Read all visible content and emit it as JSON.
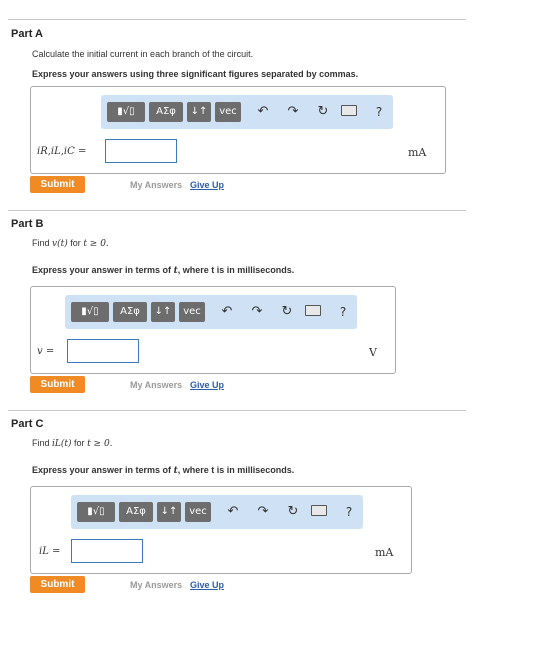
{
  "toolbar": {
    "fraction_root": "▮√▯",
    "greek": "ΑΣφ",
    "updown": "↓↑",
    "vec": "vec",
    "undo": "↶",
    "redo": "↷",
    "reset": "↻",
    "help": "?"
  },
  "common": {
    "submit": "Submit",
    "my_answers": "My Answers",
    "give_up": "Give Up"
  },
  "partA": {
    "title": "Part A",
    "instruction": "Calculate the initial current in each branch of the circuit.",
    "format": "Express your answers using three significant figures separated by commas.",
    "var_label": "iR,iL,iC =",
    "input_value": "",
    "unit": "mA"
  },
  "partB": {
    "title": "Part B",
    "instruction_prefix": "Find",
    "instruction_expr": "v(t)",
    "instruction_mid": "for",
    "instruction_cond": "t ≥ 0.",
    "format_prefix": "Express your answer in terms of",
    "format_var": "t",
    "format_suffix": ", where t is in milliseconds.",
    "var_label": "v =",
    "input_value": "",
    "unit": "V"
  },
  "partC": {
    "title": "Part C",
    "instruction_prefix": "Find",
    "instruction_expr": "iL(t)",
    "instruction_mid": "for",
    "instruction_cond": "t ≥ 0.",
    "format_prefix": "Express your answer in terms of",
    "format_var": "t",
    "format_suffix": ", where t is in milliseconds.",
    "var_label": "iL =",
    "input_value": "",
    "unit": "mA"
  }
}
